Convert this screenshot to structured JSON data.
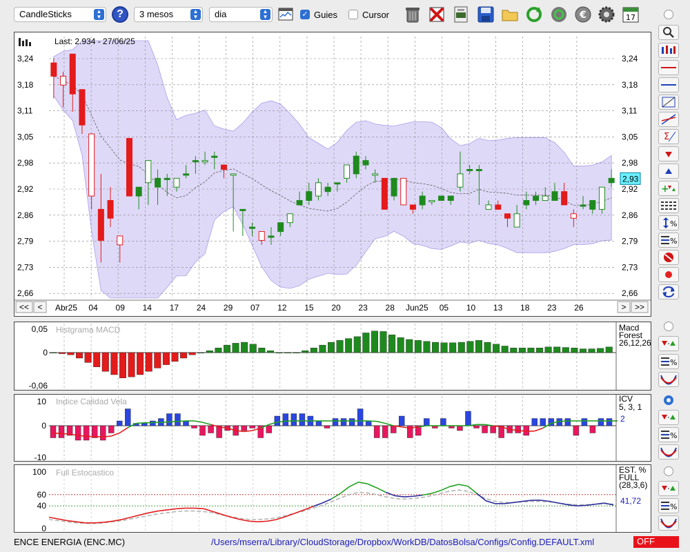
{
  "toolbar": {
    "chart_type": "CandleSticks",
    "period": "3 mesos",
    "interval": "dia",
    "guies_label": "Guies",
    "guies_checked": true,
    "cursor_label": "Cursor",
    "cursor_checked": false,
    "help_label": "?",
    "icons": [
      "trash-icon",
      "delete-icon",
      "print-icon",
      "save-icon",
      "open-folder-icon",
      "refresh-icon",
      "refresh-all-icon",
      "currency-icon",
      "settings-icon",
      "calendar-icon"
    ],
    "calendar_day": "17"
  },
  "main_chart": {
    "last_label": "Last: 2.934 - 27/06/25",
    "price_tag": "2,93",
    "y_labels": [
      "3,24",
      "3,18",
      "3,11",
      "3,05",
      "2,98",
      "2,92",
      "2,86",
      "2,79",
      "2,73",
      "2,66"
    ],
    "x_labels": [
      "Abr25",
      "04",
      "09",
      "14",
      "17",
      "24",
      "29",
      "07",
      "12",
      "15",
      "20",
      "23",
      "28",
      "Jun25",
      "05",
      "10",
      "13",
      "18",
      "23",
      "26"
    ],
    "nav": {
      "first": "<<",
      "prev": "<",
      "next": ">",
      "last": ">>"
    }
  },
  "macd_panel": {
    "title": "Histgrama MACD",
    "y_labels": [
      "0,05",
      "0",
      "-0,06"
    ],
    "side_lines": [
      "Macd",
      "Forest",
      "26,12,26"
    ]
  },
  "icv_panel": {
    "title": "Indice Calidad Vela",
    "y_labels": [
      "10",
      "0",
      "-10"
    ],
    "side_lines": [
      "ICV",
      "5, 3, 1"
    ],
    "value": "2"
  },
  "stoch_panel": {
    "title": "Full Estocastico",
    "y_labels": [
      "100",
      "60",
      "40",
      "0"
    ],
    "side_lines": [
      "EST. %",
      "FULL",
      "(28,3,6)"
    ],
    "value": "41,72"
  },
  "status": {
    "name": "ENCE ENERGIA (ENC.MC)",
    "path": "/Users/mserra/Library/CloudStorage/Dropbox/WorkDB/DatosBolsa/Configs/Config.DEFAULT.xml",
    "mode": "OFF"
  },
  "colors": {
    "up": "#1e8a1e",
    "down": "#e31b1b",
    "band": "#d9d2f7",
    "accent": "#2d6fd3"
  },
  "chart_data": [
    {
      "type": "candlestick",
      "title": "ENCE ENERGIA (ENC.MC)",
      "x_start": "Abr25",
      "ylim": [
        2.66,
        3.24
      ],
      "candles": [
        [
          3.19,
          3.16,
          3.2,
          3.11
        ],
        [
          3.16,
          3.14,
          3.17,
          3.09
        ],
        [
          3.21,
          3.12,
          3.21,
          3.08
        ],
        [
          3.13,
          3.05,
          3.13,
          3.03
        ],
        [
          3.03,
          2.89,
          3.03,
          2.86
        ],
        [
          2.86,
          2.79,
          2.94,
          2.74
        ],
        [
          2.88,
          2.84,
          2.91,
          2.82
        ],
        [
          2.8,
          2.78,
          2.8,
          2.74
        ],
        [
          3.02,
          2.89,
          3.02,
          2.89
        ],
        [
          2.89,
          2.91,
          2.91,
          2.86
        ],
        [
          2.92,
          2.97,
          2.97,
          2.87
        ],
        [
          2.91,
          2.93,
          2.95,
          2.87
        ],
        [
          2.93,
          2.93,
          2.94,
          2.89
        ],
        [
          2.91,
          2.93,
          2.93,
          2.9
        ],
        [
          2.94,
          2.94,
          2.96,
          2.93
        ],
        [
          2.97,
          2.97,
          2.98,
          2.94
        ],
        [
          2.97,
          2.97,
          2.99,
          2.96
        ],
        [
          2.98,
          2.98,
          2.99,
          2.95
        ],
        [
          2.96,
          2.95,
          2.96,
          2.93
        ],
        [
          2.94,
          2.94,
          2.94,
          2.81
        ],
        [
          2.86,
          2.86,
          2.86,
          2.8
        ],
        [
          2.82,
          2.82,
          2.83,
          2.8
        ],
        [
          2.81,
          2.79,
          2.81,
          2.78
        ],
        [
          2.8,
          2.8,
          2.82,
          2.78
        ],
        [
          2.81,
          2.83,
          2.83,
          2.8
        ],
        [
          2.83,
          2.85,
          2.85,
          2.82
        ],
        [
          2.87,
          2.88,
          2.9,
          2.87
        ],
        [
          2.88,
          2.9,
          2.92,
          2.87
        ],
        [
          2.89,
          2.92,
          2.93,
          2.88
        ],
        [
          2.9,
          2.91,
          2.92,
          2.89
        ],
        [
          2.92,
          2.92,
          2.92,
          2.9
        ],
        [
          2.93,
          2.96,
          2.96,
          2.92
        ],
        [
          2.94,
          2.98,
          2.99,
          2.93
        ],
        [
          2.96,
          2.97,
          2.98,
          2.95
        ],
        [
          2.94,
          2.94,
          2.95,
          2.92
        ],
        [
          2.93,
          2.86,
          2.93,
          2.86
        ],
        [
          2.89,
          2.93,
          2.93,
          2.88
        ],
        [
          2.93,
          2.87,
          2.93,
          2.87
        ],
        [
          2.87,
          2.86,
          2.87,
          2.85
        ],
        [
          2.87,
          2.89,
          2.9,
          2.86
        ],
        [
          2.88,
          2.88,
          2.88,
          2.87
        ],
        [
          2.88,
          2.89,
          2.89,
          2.88
        ],
        [
          2.88,
          2.89,
          2.89,
          2.87
        ],
        [
          2.91,
          2.94,
          2.99,
          2.9
        ],
        [
          2.95,
          2.95,
          2.96,
          2.94
        ],
        [
          2.95,
          2.95,
          2.96,
          2.87
        ],
        [
          2.86,
          2.87,
          2.88,
          2.86
        ],
        [
          2.87,
          2.86,
          2.88,
          2.86
        ],
        [
          2.85,
          2.84,
          2.85,
          2.82
        ],
        [
          2.82,
          2.85,
          2.87,
          2.82
        ],
        [
          2.87,
          2.88,
          2.9,
          2.86
        ],
        [
          2.88,
          2.89,
          2.9,
          2.87
        ],
        [
          2.88,
          2.89,
          2.91,
          2.88
        ],
        [
          2.88,
          2.9,
          2.92,
          2.88
        ],
        [
          2.9,
          2.87,
          2.92,
          2.87
        ],
        [
          2.85,
          2.84,
          2.86,
          2.82
        ],
        [
          2.87,
          2.87,
          2.89,
          2.86
        ],
        [
          2.86,
          2.88,
          2.88,
          2.85
        ],
        [
          2.86,
          2.91,
          2.91,
          2.85
        ],
        [
          2.92,
          2.93,
          2.95,
          2.91
        ]
      ]
    },
    {
      "type": "bar",
      "title": "Histgrama MACD",
      "ylim": [
        -0.06,
        0.05
      ],
      "values": [
        0.0,
        -0.002,
        -0.004,
        -0.01,
        -0.018,
        -0.026,
        -0.034,
        -0.04,
        -0.046,
        -0.044,
        -0.04,
        -0.034,
        -0.028,
        -0.022,
        -0.016,
        -0.01,
        -0.004,
        0.0,
        0.004,
        0.01,
        0.016,
        0.02,
        0.022,
        0.018,
        0.01,
        0.004,
        0.0,
        0.0,
        0.0,
        0.004,
        0.01,
        0.016,
        0.022,
        0.026,
        0.03,
        0.034,
        0.042,
        0.046,
        0.045,
        0.038,
        0.032,
        0.028,
        0.026,
        0.024,
        0.022,
        0.021,
        0.021,
        0.022,
        0.024,
        0.026,
        0.022,
        0.018,
        0.014,
        0.01,
        0.01,
        0.01,
        0.01,
        0.012,
        0.012,
        0.011,
        0.01,
        0.008,
        0.008,
        0.009,
        0.012
      ]
    },
    {
      "type": "bar",
      "title": "Indice Calidad Vela",
      "ylim": [
        -10,
        10
      ],
      "values": [
        -5,
        -5,
        -4,
        -6,
        -6,
        -5,
        -6,
        -3,
        2,
        7,
        1,
        1,
        2,
        3,
        5,
        5,
        2,
        -1,
        -4,
        -3,
        -5,
        -2,
        -4,
        -2,
        -1,
        -5,
        -3,
        4,
        5,
        5,
        5,
        4,
        2,
        -1,
        3,
        3,
        3,
        7,
        2,
        -5,
        -5,
        -3,
        4,
        -5,
        -4,
        3,
        -1,
        3,
        -1,
        -2,
        6,
        -1,
        -3,
        -3,
        -5,
        -3,
        -3,
        -4,
        3,
        3,
        3,
        3,
        3,
        -4,
        3,
        -3,
        3,
        3
      ],
      "series": [
        {
          "name": "ICV",
          "values": [
            -3.1,
            -3.2,
            -3.5,
            -4.0,
            -4.4,
            -4.5,
            -4.6,
            -4.3,
            -3.0,
            -0.8,
            1.0,
            1.2,
            1.3,
            1.4,
            1.6,
            1.8,
            2.0,
            2.0,
            1.4,
            0.5,
            -0.5,
            -1.0,
            -2.0,
            -2.4,
            -2.0,
            -1.0,
            0.5,
            1.5,
            1.9,
            2.0,
            2.0,
            2.0,
            2.0,
            2.0,
            2.0,
            2.0,
            2.0,
            2.0,
            2.0,
            1.8,
            1.0,
            0.0,
            -0.5,
            -1.0,
            -0.5,
            0.0,
            0.0,
            0.0,
            0.0,
            0.0,
            0.0,
            0.5,
            0.5,
            0.0,
            -0.5,
            -1.5,
            -2.0,
            -2.3,
            -2.2,
            -1.0,
            1.0,
            1.8,
            2.0,
            2.0,
            2.0,
            2.0,
            2.0,
            2.0,
            2.0
          ]
        }
      ]
    },
    {
      "type": "line",
      "title": "Full Estocastico",
      "ylim": [
        0,
        100
      ],
      "series": [
        {
          "name": "EST. % FULL",
          "values": [
            20,
            17,
            14,
            12,
            10,
            10,
            11,
            13,
            16,
            20,
            24,
            28,
            31,
            33,
            35,
            36,
            36,
            35,
            30,
            25,
            20,
            16,
            13,
            12,
            13,
            16,
            21,
            27,
            33,
            39,
            45,
            52,
            62,
            74,
            82,
            79,
            72,
            64,
            58,
            56,
            57,
            59,
            62,
            67,
            74,
            78,
            75,
            62,
            49,
            44,
            44,
            46,
            48,
            50,
            50,
            48,
            45,
            42,
            40,
            41,
            43,
            45,
            41.72
          ]
        },
        {
          "name": "EST. % FULL",
          "values": [
            16,
            14,
            12,
            10,
            9,
            9,
            10,
            12,
            14,
            17,
            20,
            23,
            26,
            28,
            30,
            31,
            31,
            30,
            28,
            24,
            21,
            18,
            16,
            16,
            17,
            19,
            23,
            27,
            31,
            36,
            41,
            47,
            54,
            60,
            64,
            63,
            60,
            56,
            53,
            52,
            53,
            55,
            58,
            62,
            66,
            68,
            66,
            60,
            53,
            48,
            46,
            46,
            47,
            48,
            48,
            47,
            45,
            43,
            42,
            42,
            43,
            44,
            43
          ]
        }
      ]
    }
  ]
}
